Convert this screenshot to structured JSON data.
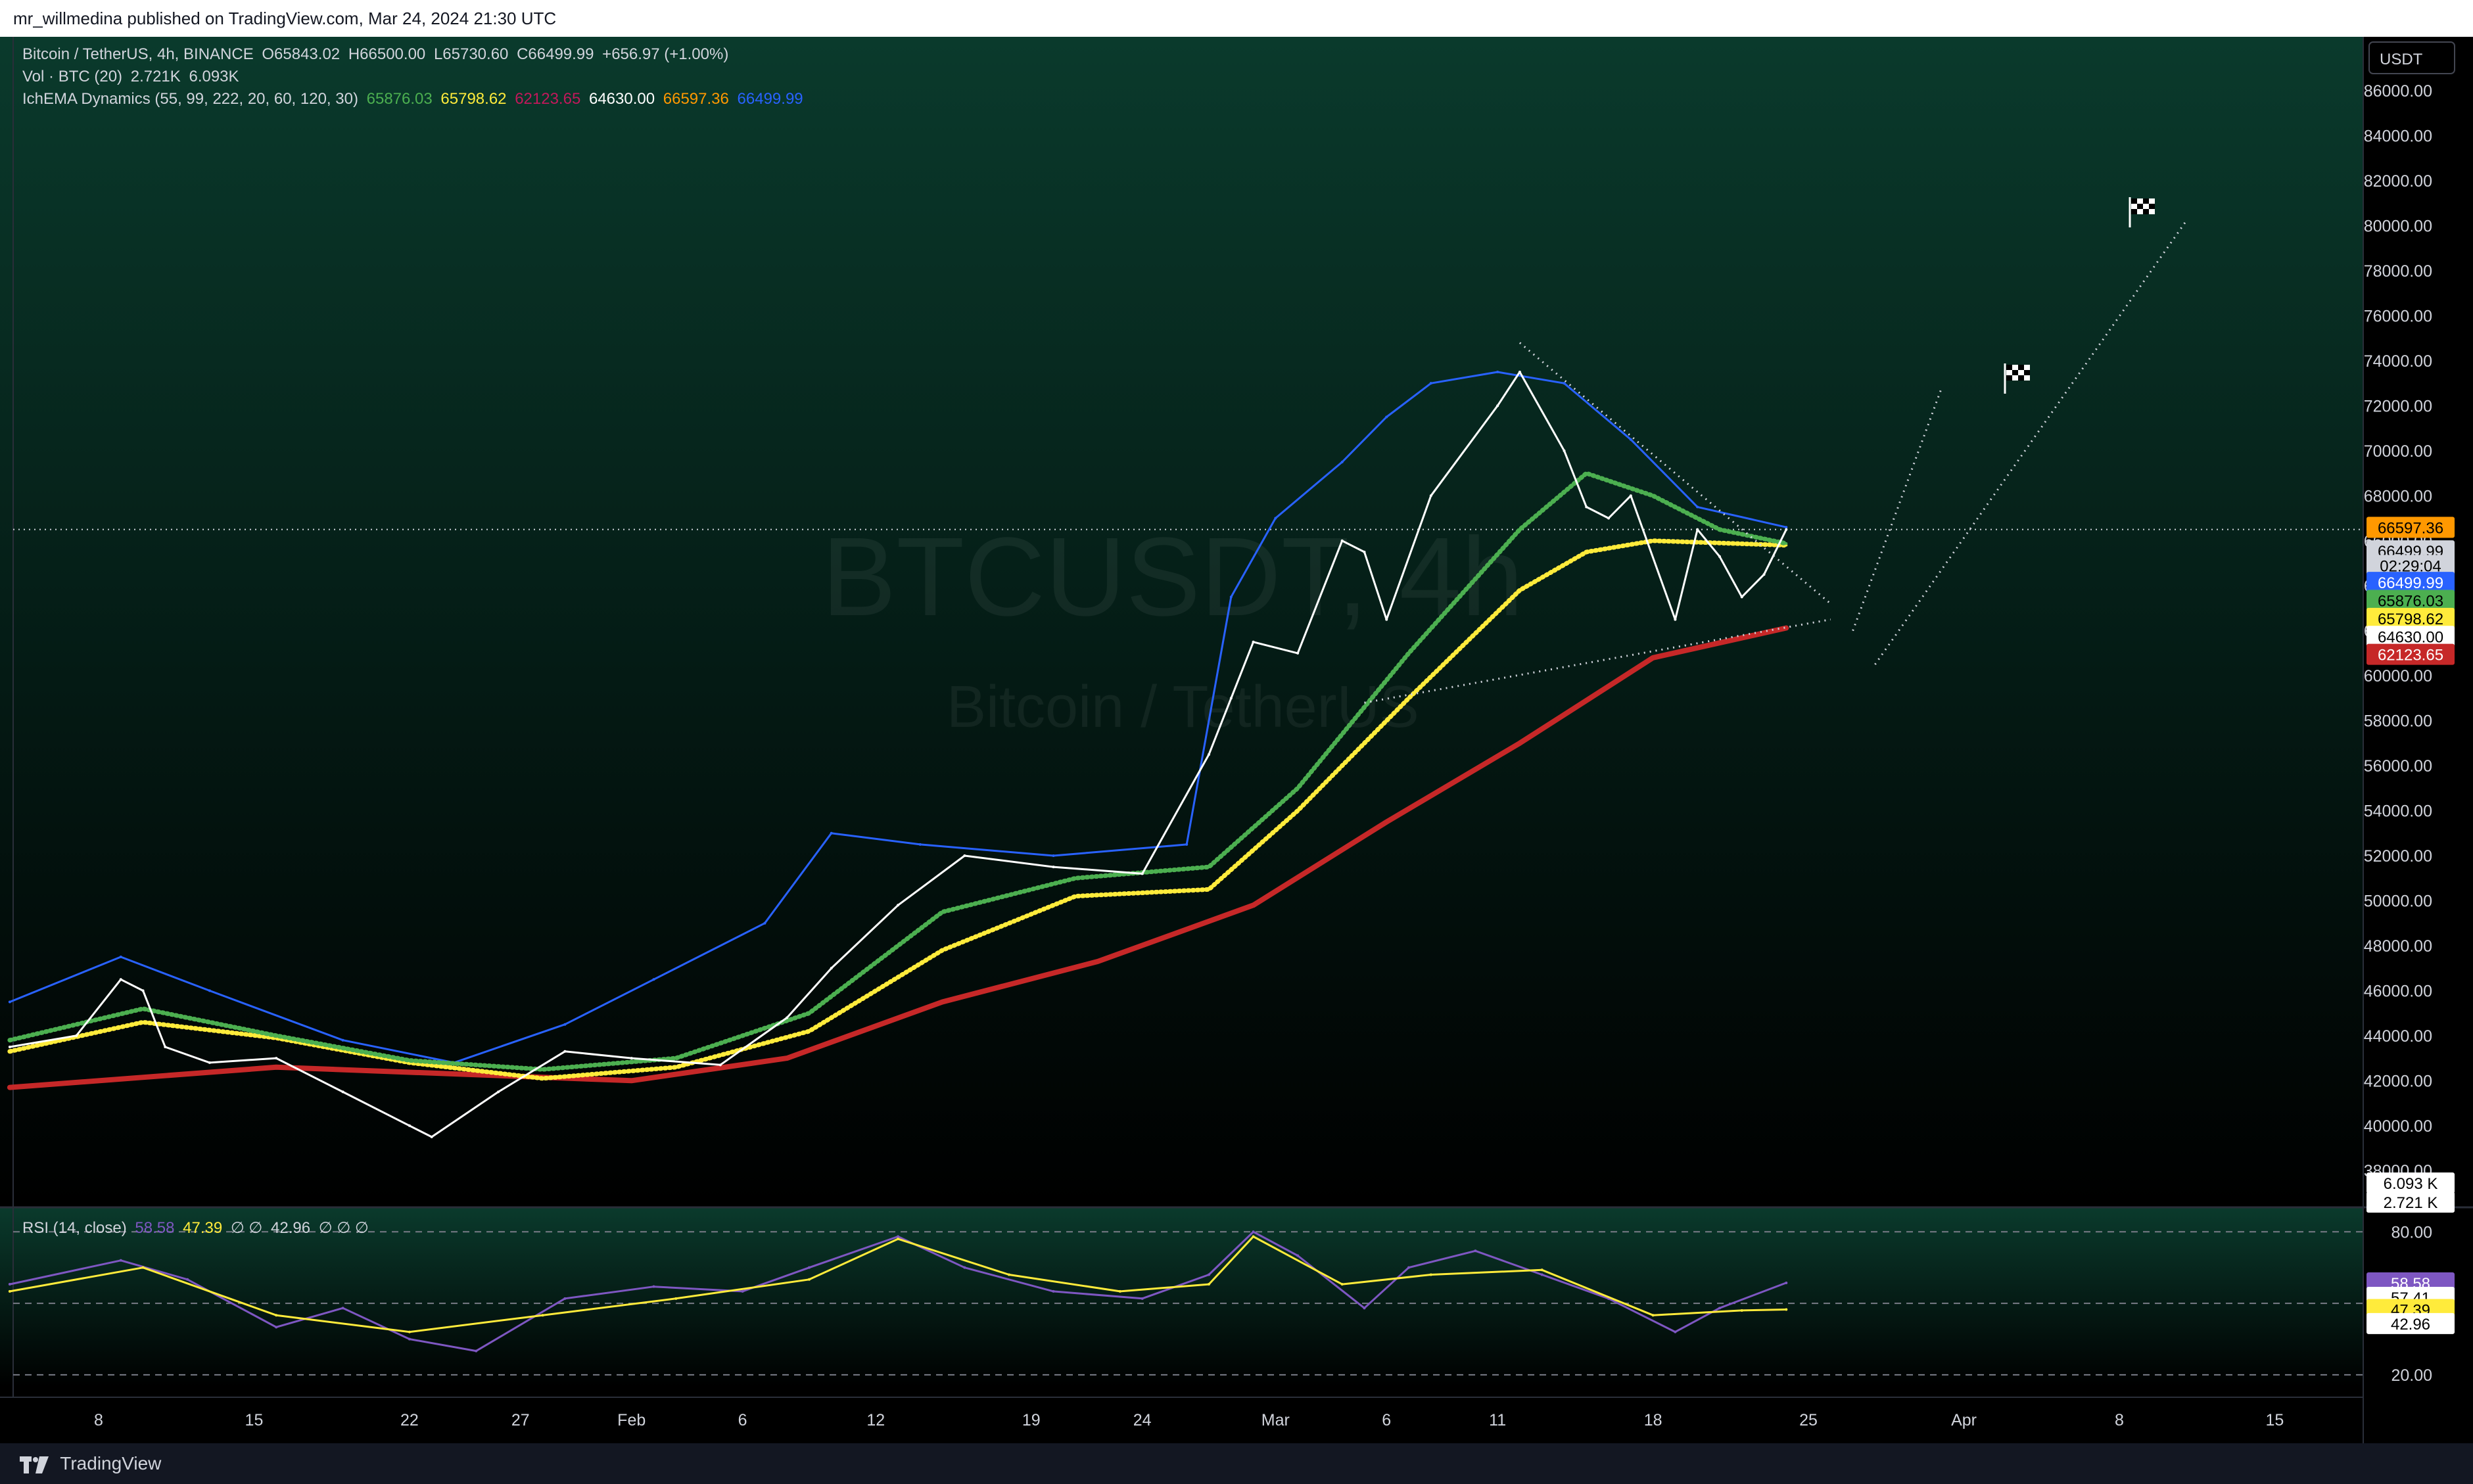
{
  "publisher": "mr_willmedina published on TradingView.com, Mar 24, 2024 21:30 UTC",
  "brand": "TradingView",
  "watermark": {
    "symbol": "BTCUSDT, 4h",
    "name": "Bitcoin / TetherUS"
  },
  "legend": {
    "main": {
      "symbol": "Bitcoin / TetherUS, 4h, BINANCE",
      "o": "O65843.02",
      "h": "H66500.00",
      "l": "L65730.60",
      "c": "C66499.99",
      "chg": "+656.97 (+1.00%)"
    },
    "vol": {
      "label": "Vol · BTC (20)",
      "v1": "2.721K",
      "v2": "6.093K"
    },
    "ichema": {
      "label": "IchEMA Dynamics (55, 99, 222, 20, 60, 120, 30)",
      "values": [
        {
          "text": "65876.03",
          "color": "#4caf50"
        },
        {
          "text": "65798.62",
          "color": "#ffeb3b"
        },
        {
          "text": "62123.65",
          "color": "#c2185b"
        },
        {
          "text": "64630.00",
          "color": "#ffffff"
        },
        {
          "text": "66597.36",
          "color": "#ff9800"
        },
        {
          "text": "66499.99",
          "color": "#2962ff"
        }
      ]
    },
    "rsi": {
      "label": "RSI (14, close)",
      "v1": "58.58",
      "v2": "47.39",
      "nulls1": "∅ ∅",
      "v3": "42.96",
      "nulls2": "∅ ∅ ∅"
    }
  },
  "currency": "USDT",
  "colors": {
    "bg": "#000000",
    "candle": "#ffffff",
    "upper_band": "#2962ff",
    "ema_fast": "#4caf50",
    "ema_mid": "#ffeb3b",
    "ema_slow": "#c62828",
    "rsi": "#7e57c2",
    "rsi_ma": "#ffeb3b"
  },
  "chart_data": [
    {
      "type": "line",
      "panel": "price",
      "ylim": [
        36400,
        88400
      ],
      "ytick_labels": [
        "38000.00",
        "40000.00",
        "42000.00",
        "44000.00",
        "46000.00",
        "48000.00",
        "50000.00",
        "52000.00",
        "54000.00",
        "56000.00",
        "58000.00",
        "60000.00",
        "62000.00",
        "64000.00",
        "66000.00",
        "68000.00",
        "70000.00",
        "72000.00",
        "74000.00",
        "76000.00",
        "78000.00",
        "80000.00",
        "82000.00",
        "84000.00",
        "86000.00"
      ],
      "xtick_labels": [
        "8",
        "15",
        "22",
        "27",
        "Feb",
        "6",
        "12",
        "19",
        "24",
        "Mar",
        "6",
        "11",
        "18",
        "25",
        "Apr",
        "8",
        "15"
      ],
      "x_dates": [
        "2024-01-08",
        "2024-01-15",
        "2024-01-22",
        "2024-01-27",
        "2024-02-01",
        "2024-02-06",
        "2024-02-12",
        "2024-02-19",
        "2024-02-24",
        "2024-03-01",
        "2024-03-06",
        "2024-03-11",
        "2024-03-18",
        "2024-03-25",
        "2024-04-01",
        "2024-04-08",
        "2024-04-15"
      ],
      "series": [
        {
          "key": "close",
          "x": [
            "2024-01-04",
            "2024-01-07",
            "2024-01-09",
            "2024-01-10",
            "2024-01-11",
            "2024-01-13",
            "2024-01-16",
            "2024-01-19",
            "2024-01-22",
            "2024-01-23",
            "2024-01-26",
            "2024-01-29",
            "2024-02-01",
            "2024-02-05",
            "2024-02-08",
            "2024-02-10",
            "2024-02-13",
            "2024-02-16",
            "2024-02-20",
            "2024-02-24",
            "2024-02-27",
            "2024-02-28",
            "2024-02-29",
            "2024-03-02",
            "2024-03-04",
            "2024-03-05",
            "2024-03-06",
            "2024-03-08",
            "2024-03-11",
            "2024-03-12",
            "2024-03-14",
            "2024-03-15",
            "2024-03-16",
            "2024-03-17",
            "2024-03-19",
            "2024-03-20",
            "2024-03-21",
            "2024-03-22",
            "2024-03-23",
            "2024-03-24"
          ],
          "y": [
            43500,
            44000,
            46500,
            46000,
            43500,
            42800,
            43000,
            41500,
            40000,
            39500,
            41500,
            43300,
            43000,
            42700,
            44800,
            47000,
            49800,
            52000,
            51500,
            51200,
            56500,
            59000,
            61500,
            61000,
            66000,
            65500,
            62500,
            68000,
            72000,
            73500,
            70000,
            67500,
            67000,
            68000,
            62500,
            66500,
            65300,
            63500,
            64500,
            66500
          ]
        },
        {
          "key": "upper-band",
          "x": [
            "2024-01-04",
            "2024-01-09",
            "2024-01-13",
            "2024-01-19",
            "2024-01-24",
            "2024-01-29",
            "2024-02-02",
            "2024-02-07",
            "2024-02-10",
            "2024-02-14",
            "2024-02-20",
            "2024-02-26",
            "2024-02-28",
            "2024-03-01",
            "2024-03-04",
            "2024-03-06",
            "2024-03-08",
            "2024-03-11",
            "2024-03-14",
            "2024-03-17",
            "2024-03-20",
            "2024-03-24"
          ],
          "y": [
            45500,
            47500,
            46000,
            43800,
            42800,
            44500,
            46500,
            49000,
            53000,
            52500,
            52000,
            52500,
            63500,
            67000,
            69500,
            71500,
            73000,
            73500,
            73000,
            70500,
            67500,
            66600
          ]
        },
        {
          "key": "ema-fast",
          "x": [
            "2024-01-04",
            "2024-01-10",
            "2024-01-16",
            "2024-01-22",
            "2024-01-28",
            "2024-02-03",
            "2024-02-09",
            "2024-02-15",
            "2024-02-21",
            "2024-02-27",
            "2024-03-02",
            "2024-03-07",
            "2024-03-12",
            "2024-03-15",
            "2024-03-18",
            "2024-03-21",
            "2024-03-24"
          ],
          "y": [
            43800,
            45200,
            44000,
            42900,
            42500,
            43000,
            45000,
            49500,
            51000,
            51500,
            55000,
            61000,
            66500,
            69000,
            68000,
            66500,
            65876
          ]
        },
        {
          "key": "ema-mid",
          "x": [
            "2024-01-04",
            "2024-01-10",
            "2024-01-16",
            "2024-01-22",
            "2024-01-28",
            "2024-02-03",
            "2024-02-09",
            "2024-02-15",
            "2024-02-21",
            "2024-02-27",
            "2024-03-02",
            "2024-03-07",
            "2024-03-12",
            "2024-03-15",
            "2024-03-18",
            "2024-03-21",
            "2024-03-24"
          ],
          "y": [
            43300,
            44600,
            43900,
            42800,
            42100,
            42600,
            44200,
            47800,
            50200,
            50500,
            54000,
            59000,
            63800,
            65500,
            66000,
            65900,
            65798
          ]
        },
        {
          "key": "ema-slow",
          "x": [
            "2024-01-04",
            "2024-01-16",
            "2024-01-24",
            "2024-02-01",
            "2024-02-08",
            "2024-02-15",
            "2024-02-22",
            "2024-02-29",
            "2024-03-06",
            "2024-03-12",
            "2024-03-18",
            "2024-03-24"
          ],
          "y": [
            41700,
            42600,
            42300,
            42000,
            43000,
            45500,
            47300,
            49800,
            53500,
            57000,
            60800,
            62123
          ]
        }
      ],
      "trendlines": [
        {
          "from": [
            "2024-03-12",
            74800
          ],
          "to": [
            "2024-03-26",
            63200
          ]
        },
        {
          "from": [
            "2024-03-05",
            58800
          ],
          "to": [
            "2024-03-26",
            62500
          ]
        },
        {
          "from": [
            "2024-03-27",
            62000
          ],
          "to": [
            "2024-03-31",
            72800
          ]
        },
        {
          "from": [
            "2024-03-28",
            60500
          ],
          "to": [
            "2024-04-11",
            80200
          ]
        }
      ],
      "axis_labels": [
        {
          "text": "66597.36",
          "value": 66597.36,
          "bg": "#ff9800",
          "fg": "#000000"
        },
        {
          "text": "66499.99",
          "value": 65550,
          "bg": "#d1d4dc",
          "fg": "#000000"
        },
        {
          "text": "02:29:04",
          "value": 64900,
          "bg": "#d1d4dc",
          "fg": "#000000"
        },
        {
          "text": "66499.99",
          "value": 64150,
          "bg": "#2962ff",
          "fg": "#ffffff"
        },
        {
          "text": "65876.03",
          "value": 63350,
          "bg": "#4caf50",
          "fg": "#000000"
        },
        {
          "text": "65798.62",
          "value": 62550,
          "bg": "#ffeb3b",
          "fg": "#000000"
        },
        {
          "text": "64630.00",
          "value": 61750,
          "bg": "#ffffff",
          "fg": "#000000"
        },
        {
          "text": "62123.65",
          "value": 60950,
          "bg": "#c62828",
          "fg": "#ffffff"
        },
        {
          "text": "6.093 K",
          "value": 37450,
          "bg": "#ffffff",
          "fg": "#000000"
        },
        {
          "text": "2.721 K",
          "value": 36600,
          "bg": "#ffffff",
          "fg": "#000000"
        }
      ]
    },
    {
      "type": "line",
      "panel": "rsi",
      "ylim": [
        15,
        90
      ],
      "ytick_labels": [
        "20.00",
        "80.00"
      ],
      "series": [
        {
          "key": "rsi",
          "x": [
            "2024-01-04",
            "2024-01-09",
            "2024-01-12",
            "2024-01-16",
            "2024-01-19",
            "2024-01-22",
            "2024-01-25",
            "2024-01-29",
            "2024-02-02",
            "2024-02-06",
            "2024-02-09",
            "2024-02-13",
            "2024-02-16",
            "2024-02-20",
            "2024-02-24",
            "2024-02-27",
            "2024-02-29",
            "2024-03-02",
            "2024-03-05",
            "2024-03-07",
            "2024-03-10",
            "2024-03-13",
            "2024-03-16",
            "2024-03-19",
            "2024-03-21",
            "2024-03-24"
          ],
          "y": [
            58,
            68,
            60,
            40,
            48,
            35,
            30,
            52,
            57,
            55,
            65,
            78,
            65,
            55,
            52,
            62,
            80,
            70,
            48,
            65,
            72,
            62,
            52,
            38,
            48,
            58.58
          ]
        },
        {
          "key": "rsi-ma",
          "x": [
            "2024-01-04",
            "2024-01-10",
            "2024-01-16",
            "2024-01-22",
            "2024-01-28",
            "2024-02-03",
            "2024-02-09",
            "2024-02-13",
            "2024-02-18",
            "2024-02-23",
            "2024-02-27",
            "2024-02-29",
            "2024-03-04",
            "2024-03-08",
            "2024-03-13",
            "2024-03-18",
            "2024-03-22",
            "2024-03-24"
          ],
          "y": [
            55,
            65,
            45,
            38,
            45,
            52,
            60,
            77,
            62,
            55,
            58,
            78,
            58,
            62,
            64,
            45,
            47,
            47.39
          ]
        }
      ],
      "axis_labels": [
        {
          "text": "58.58",
          "value": 58.58,
          "bg": "#7e57c2",
          "fg": "#ffffff"
        },
        {
          "text": "57.41",
          "value": 52.5,
          "bg": "#ffffff",
          "fg": "#000000"
        },
        {
          "text": "47.39",
          "value": 47.39,
          "bg": "#ffeb3b",
          "fg": "#000000"
        },
        {
          "text": "42.96",
          "value": 41.5,
          "bg": "#ffffff",
          "fg": "#000000"
        }
      ]
    }
  ]
}
